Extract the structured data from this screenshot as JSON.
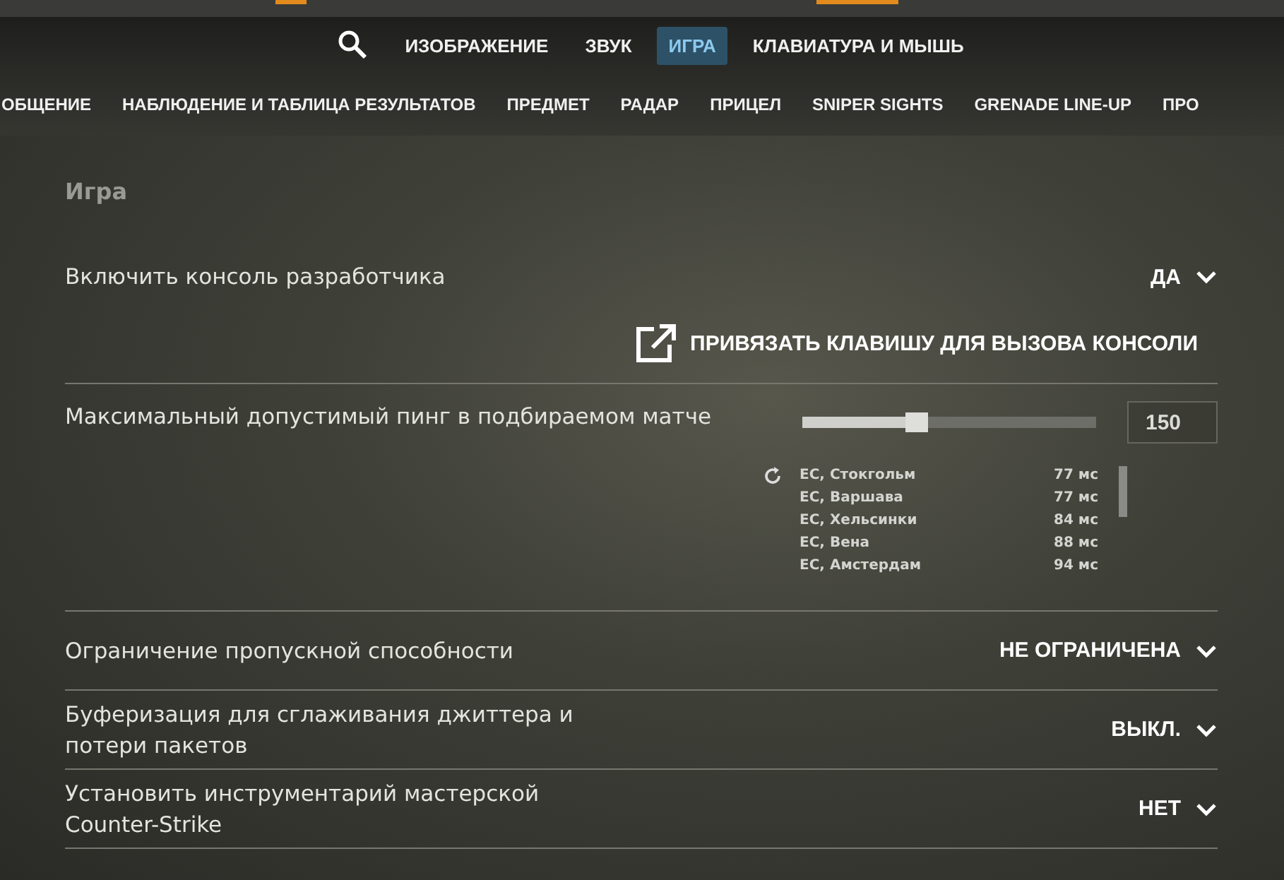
{
  "top_tabs": [
    {
      "label": "ИЗОБРАЖЕНИЕ",
      "selected": false
    },
    {
      "label": "ЗВУК",
      "selected": false
    },
    {
      "label": "ИГРА",
      "selected": true
    },
    {
      "label": "КЛАВИАТУРА И МЫШЬ",
      "selected": false
    }
  ],
  "sub_tabs": [
    {
      "label": "ОБЩЕНИЕ",
      "selected": false
    },
    {
      "label": "НАБЛЮДЕНИЕ И ТАБЛИЦА РЕЗУЛЬТАТОВ",
      "selected": false
    },
    {
      "label": "ПРЕДМЕТ",
      "selected": false
    },
    {
      "label": "РАДАР",
      "selected": false
    },
    {
      "label": "ПРИЦЕЛ",
      "selected": false
    },
    {
      "label": "SNIPER SIGHTS",
      "selected": false
    },
    {
      "label": "GRENADE LINE-UP",
      "selected": false
    },
    {
      "label": "ПРО",
      "selected": false
    }
  ],
  "section_title": "Игра",
  "settings": [
    {
      "kind": "dropdown",
      "label": "Включить консоль разработчика",
      "value": "ДА",
      "link": "ПРИВЯЗАТЬ КЛАВИШУ ДЛЯ ВЫЗОВА КОНСОЛИ"
    },
    {
      "kind": "slider",
      "label": "Максимальный допустимый пинг в подбираемом матче",
      "level": 0.39,
      "value": "150",
      "servers": [
        {
          "name": "EC, Стокгольм",
          "ping": "77 мс"
        },
        {
          "name": "EC, Варшава",
          "ping": "77 мс"
        },
        {
          "name": "EC, Хельсинки",
          "ping": "84 мс"
        },
        {
          "name": "EC, Вена",
          "ping": "88 мс"
        },
        {
          "name": "EC, Амстердам",
          "ping": "94 мс"
        }
      ]
    },
    {
      "kind": "dropdown",
      "label": "Ограничение пропускной способности",
      "value": "НЕ ОГРАНИЧЕНА"
    },
    {
      "kind": "dropdown",
      "label": "Буферизация для сглаживания джиттера и потери пакетов",
      "value": "ВЫКЛ."
    },
    {
      "kind": "dropdown",
      "label": "Установить инструментарий мастерской Counter-Strike",
      "value": "НЕТ"
    }
  ]
}
